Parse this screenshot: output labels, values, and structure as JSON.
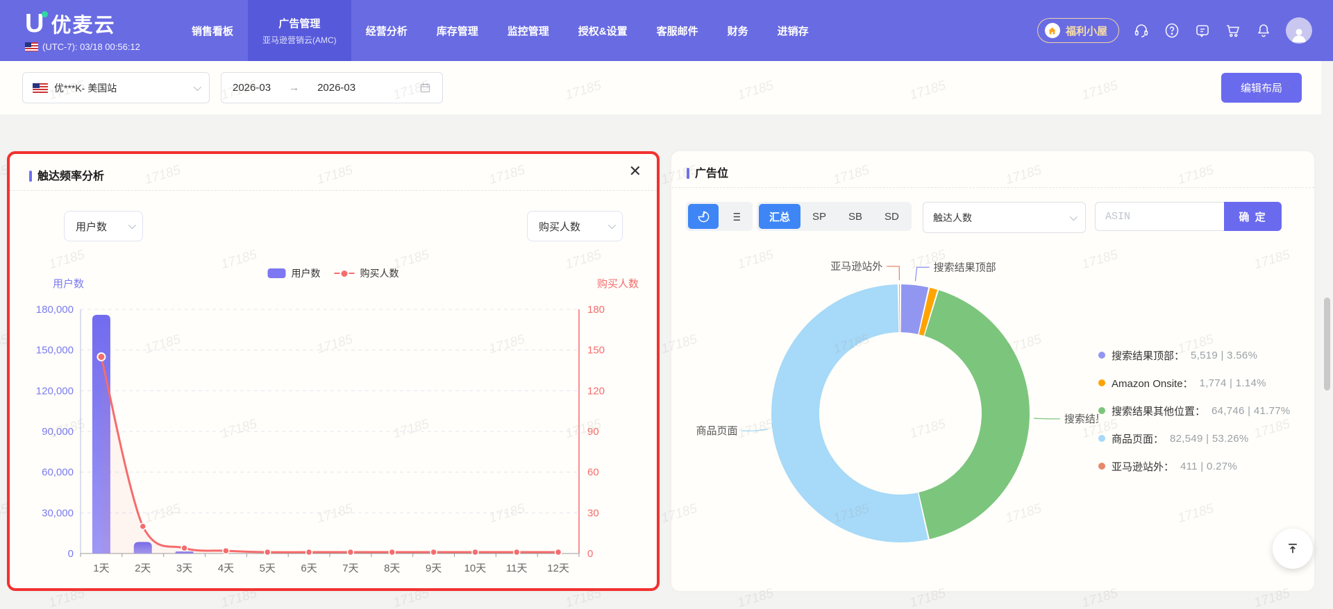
{
  "nav": {
    "logo_text": "优麦云",
    "time": "(UTC-7): 03/18 00:56:12",
    "items": [
      {
        "label": "销售看板",
        "active": false
      },
      {
        "label": "广告管理",
        "active": true,
        "subtitle": "亚马逊营销云(AMC)"
      },
      {
        "label": "经营分析",
        "active": false
      },
      {
        "label": "库存管理",
        "active": false
      },
      {
        "label": "监控管理",
        "active": false
      },
      {
        "label": "授权&设置",
        "active": false
      },
      {
        "label": "客服邮件",
        "active": false
      },
      {
        "label": "财务",
        "active": false
      },
      {
        "label": "进销存",
        "active": false
      }
    ],
    "welfare_label": "福利小屋",
    "icon_names": [
      "support-icon",
      "help-icon",
      "feedback-icon",
      "cart-icon",
      "bell-icon",
      "avatar"
    ]
  },
  "filters": {
    "account": "优***K- 美国站",
    "date_start": "2026-03",
    "range_separator": "→",
    "date_end": "2026-03",
    "edit_layout_label": "编辑布局"
  },
  "reach_panel": {
    "title": "触达频率分析",
    "metric_select": "用户数",
    "secondary_select": "购买人数"
  },
  "placement_panel": {
    "title": "广告位",
    "view_tabs": [
      "汇总",
      "SP",
      "SB",
      "SD"
    ],
    "active_view": "汇总",
    "metric_select": "触达人数",
    "asin_placeholder": "ASIN",
    "confirm_label": "确 定"
  },
  "watermark": "17185",
  "colors": {
    "nav_bg": "#696be3",
    "nav_active": "#5659da",
    "highlight_border": "#f2312f",
    "primary_button": "#6a6aef",
    "active_blue": "#3e86f6",
    "bar_purple": "#7c77f1",
    "line_red": "#f56c6c"
  },
  "chart_data": [
    {
      "id": "reach_frequency",
      "type": "bar+line",
      "categories": [
        "1天",
        "2天",
        "3天",
        "4天",
        "5天",
        "6天",
        "7天",
        "8天",
        "9天",
        "10天",
        "11天",
        "12天"
      ],
      "series": [
        {
          "name": "用户数",
          "type": "bar",
          "axis": "left",
          "color": "#7c77f1",
          "values": [
            176000,
            8500,
            1500,
            0,
            0,
            0,
            0,
            0,
            0,
            0,
            0,
            0
          ]
        },
        {
          "name": "购买人数",
          "type": "line",
          "axis": "right",
          "color": "#f56c6c",
          "values": [
            145,
            20,
            4,
            2,
            1,
            1,
            1,
            1,
            1,
            1,
            1,
            1
          ]
        }
      ],
      "left_axis": {
        "label": "用户数",
        "max": 180000,
        "ticks": [
          "180,000",
          "150,000",
          "120,000",
          "90,000",
          "60,000",
          "30,000",
          "0"
        ]
      },
      "right_axis": {
        "label": "购买人数",
        "max": 180,
        "ticks": [
          "180",
          "150",
          "120",
          "90",
          "60",
          "30",
          "0"
        ]
      },
      "legend": [
        "用户数",
        "购买人数"
      ],
      "grid": true
    },
    {
      "id": "ad_placement",
      "type": "donut",
      "slices": [
        {
          "label": "搜索结果顶部",
          "value": 5519,
          "value_display": "5,519",
          "pct": "3.56%",
          "color": "#9196f1",
          "callout": true
        },
        {
          "label": "Amazon Onsite",
          "value": 1774,
          "value_display": "1,774",
          "pct": "1.14%",
          "color": "#ffa300",
          "callout": false
        },
        {
          "label": "搜索结果其他位置",
          "value": 64746,
          "value_display": "64,746",
          "pct": "41.77%",
          "color": "#7cc57d",
          "callout": true
        },
        {
          "label": "商品页面",
          "value": 82549,
          "value_display": "82,549",
          "pct": "53.26%",
          "color": "#a7d9f8",
          "callout": true
        },
        {
          "label": "亚马逊站外",
          "value": 411,
          "value_display": "411",
          "pct": "0.27%",
          "color": "#e7886b",
          "callout": true
        }
      ],
      "legend_position": "right"
    }
  ]
}
